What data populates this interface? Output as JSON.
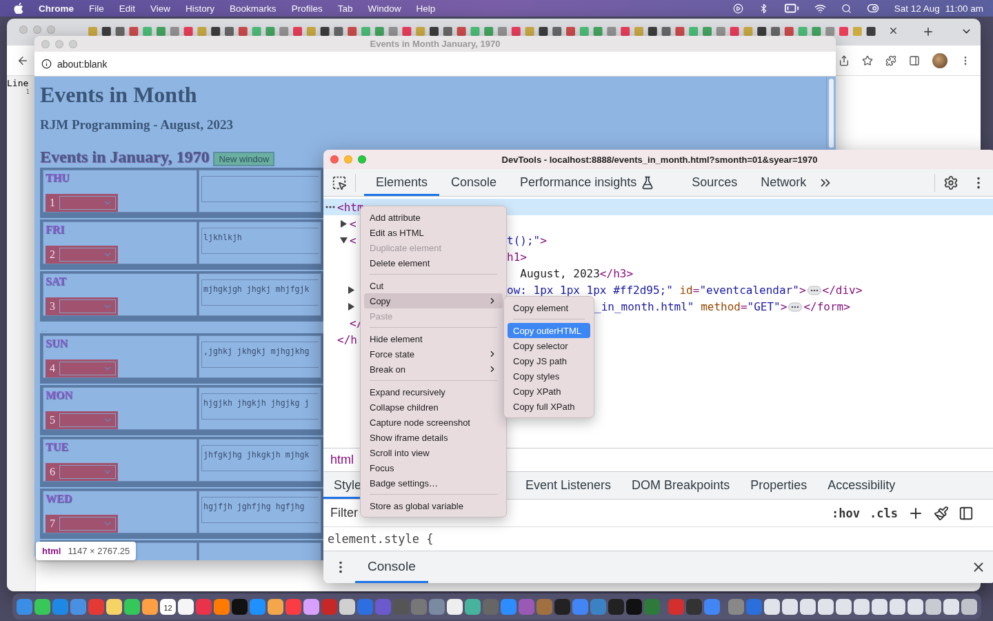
{
  "menu_bar": {
    "app": "Chrome",
    "menus": [
      "File",
      "Edit",
      "View",
      "History",
      "Bookmarks",
      "Profiles",
      "Tab",
      "Window",
      "Help"
    ],
    "date": "Sat 12 Aug",
    "time": "11:00 am"
  },
  "editor": {
    "heading": "Line",
    "line_number": "1"
  },
  "popup": {
    "title": "Events in Month January, 1970",
    "address": "about:blank",
    "heading": "Events in Month",
    "subheading": "RJM Programming - August, 2023",
    "calendar_title": "Events in January, 1970",
    "new_window_button": "New window",
    "rows": [
      {
        "kind": "day",
        "day": "THU",
        "date": "1"
      },
      {
        "kind": "day",
        "day": "FRI",
        "date": "2",
        "note": "ljkhlkjh"
      },
      {
        "kind": "day",
        "day": "SAT",
        "date": "3",
        "note": "mjhgkjgh jhgkj mhjfgjk"
      },
      {
        "kind": "gap",
        "text": ". ."
      },
      {
        "kind": "day",
        "day": "SUN",
        "date": "4",
        "note": ",jghkj jkhgkj mjhgjkhg"
      },
      {
        "kind": "day",
        "day": "MON",
        "date": "5",
        "note": "hjgjkh jhgkjh jhgjkg j"
      },
      {
        "kind": "day",
        "day": "TUE",
        "date": "6",
        "note": "jhfgkjhg jhkgkjh mjhgk"
      },
      {
        "kind": "day",
        "day": "WED",
        "date": "7",
        "note": "hgjfjh jghfjhg hgfjhg"
      },
      {
        "kind": "partial"
      }
    ]
  },
  "devtools": {
    "title": "DevTools - localhost:8888/events_in_month.html?smonth=01&syear=1970",
    "tabs": [
      {
        "label": "Elements",
        "selected": true
      },
      {
        "label": "Console",
        "selected": false
      },
      {
        "label": "Performance insights",
        "selected": false,
        "flask": true
      },
      {
        "label": "Sources",
        "selected": false
      },
      {
        "label": "Network",
        "selected": false
      }
    ],
    "tree": {
      "open": "<htm",
      "selected": true,
      "close": "</h",
      "children": [
        {
          "open": "<",
          "selected": false,
          "expanded": false
        },
        {
          "open": "<",
          "selected": false,
          "expanded": true,
          "close": "</",
          "right": [
            {
              "kind": "value",
              "text": "t();\""
            },
            {
              "kind": "tag",
              "text": ">"
            }
          ],
          "children": [
            {
              "selected": false,
              "right": [
                {
                  "kind": "tag",
                  "text": "h1>"
                }
              ]
            },
            {
              "selected": false,
              "right": [
                {
                  "kind": "plain",
                  "text": "  August, 2023"
                },
                {
                  "kind": "tag",
                  "text": "</h3>"
                }
              ]
            },
            {
              "selected": false,
              "expanded": false,
              "right": [
                {
                  "kind": "value",
                  "text": "ow: 1px 1px 1px #ff2d95;\""
                },
                {
                  "kind": "attr",
                  "text": " id"
                },
                {
                  "kind": "tag",
                  "text": "="
                },
                {
                  "kind": "value",
                  "text": "\"eventcalendar\""
                },
                {
                  "kind": "tag",
                  "text": ">"
                },
                {
                  "kind": "ellipsis"
                },
                {
                  "kind": "tag",
                  "text": "</div>"
                }
              ]
            },
            {
              "selected": false,
              "expanded": false,
              "right": [
                {
                  "kind": "value",
                  "text": "_in_month.html\""
                },
                {
                  "kind": "attr",
                  "text": " method"
                },
                {
                  "kind": "tag",
                  "text": "="
                },
                {
                  "kind": "value",
                  "text": "\"GET\""
                },
                {
                  "kind": "tag",
                  "text": ">"
                },
                {
                  "kind": "ellipsis"
                },
                {
                  "kind": "tag",
                  "text": "</form>"
                }
              ]
            }
          ]
        }
      ]
    },
    "breadcrumb": "html",
    "style_tabs": [
      {
        "label": "Style",
        "selected": true
      },
      {
        "label": "Event Listeners",
        "selected": false
      },
      {
        "label": "DOM Breakpoints",
        "selected": false
      },
      {
        "label": "Properties",
        "selected": false
      },
      {
        "label": "Accessibility",
        "selected": false
      }
    ],
    "filter_placeholder": "Filter",
    "hov": ":hov",
    "cls": ".cls",
    "style_rule": "element.style {",
    "drawer_tab": "Console"
  },
  "context_menu": [
    {
      "kind": "item",
      "label": "Add attribute",
      "disabled": false,
      "selected": false,
      "submenu": false
    },
    {
      "kind": "item",
      "label": "Edit as HTML",
      "disabled": false,
      "selected": false,
      "submenu": false
    },
    {
      "kind": "item",
      "label": "Duplicate element",
      "disabled": true,
      "selected": false,
      "submenu": false
    },
    {
      "kind": "item",
      "label": "Delete element",
      "disabled": false,
      "selected": false,
      "submenu": false
    },
    {
      "kind": "separator"
    },
    {
      "kind": "item",
      "label": "Cut",
      "disabled": false,
      "selected": false,
      "submenu": false
    },
    {
      "kind": "item",
      "label": "Copy",
      "disabled": false,
      "selected": true,
      "submenu": true
    },
    {
      "kind": "item",
      "label": "Paste",
      "disabled": true,
      "selected": false,
      "submenu": false
    },
    {
      "kind": "separator"
    },
    {
      "kind": "item",
      "label": "Hide element",
      "disabled": false,
      "selected": false,
      "submenu": false
    },
    {
      "kind": "item",
      "label": "Force state",
      "disabled": false,
      "selected": false,
      "submenu": true
    },
    {
      "kind": "item",
      "label": "Break on",
      "disabled": false,
      "selected": false,
      "submenu": true
    },
    {
      "kind": "separator"
    },
    {
      "kind": "item",
      "label": "Expand recursively",
      "disabled": false,
      "selected": false,
      "submenu": false
    },
    {
      "kind": "item",
      "label": "Collapse children",
      "disabled": false,
      "selected": false,
      "submenu": false
    },
    {
      "kind": "item",
      "label": "Capture node screenshot",
      "disabled": false,
      "selected": false,
      "submenu": false
    },
    {
      "kind": "item",
      "label": "Show iframe details",
      "disabled": false,
      "selected": false,
      "submenu": false
    },
    {
      "kind": "item",
      "label": "Scroll into view",
      "disabled": false,
      "selected": false,
      "submenu": false
    },
    {
      "kind": "item",
      "label": "Focus",
      "disabled": false,
      "selected": false,
      "submenu": false
    },
    {
      "kind": "item",
      "label": "Badge settings…",
      "disabled": false,
      "selected": false,
      "submenu": false
    },
    {
      "kind": "separator"
    },
    {
      "kind": "item",
      "label": "Store as global variable",
      "disabled": false,
      "selected": false,
      "submenu": false
    }
  ],
  "submenu": [
    {
      "kind": "item",
      "label": "Copy element",
      "selected": false
    },
    {
      "kind": "separator"
    },
    {
      "kind": "item",
      "label": "Copy outerHTML",
      "selected": true
    },
    {
      "kind": "item",
      "label": "Copy selector",
      "selected": false
    },
    {
      "kind": "item",
      "label": "Copy JS path",
      "selected": false
    },
    {
      "kind": "item",
      "label": "Copy styles",
      "selected": false
    },
    {
      "kind": "item",
      "label": "Copy XPath",
      "selected": false
    },
    {
      "kind": "item",
      "label": "Copy full XPath",
      "selected": false
    }
  ],
  "tooltip": {
    "tag": "html",
    "size": "1147 × 2767.25"
  },
  "dock": {
    "calendar_day": "12"
  }
}
